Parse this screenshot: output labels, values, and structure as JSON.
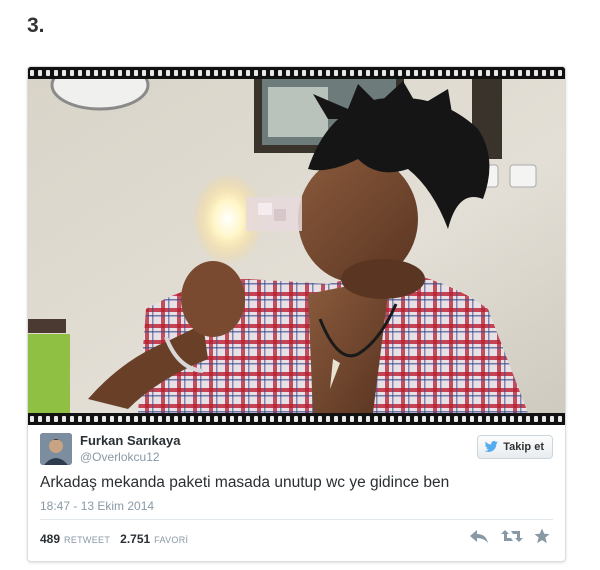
{
  "item_number": "3.",
  "tweet": {
    "display_name": "Furkan Sarıkaya",
    "handle": "@Overlokcu12",
    "follow_label": "Takip et",
    "text": "Arkadaş mekanda paketi masada unutup wc ye gidince ben",
    "timestamp": "18:47 - 13 Ekim 2014",
    "retweet_count": "489",
    "retweet_label": "RETWEET",
    "favorite_count": "2.751",
    "favorite_label": "FAVORİ"
  },
  "icons": {
    "follow": "twitter-bird-icon",
    "reply": "reply-icon",
    "retweet": "retweet-icon",
    "favorite": "star-icon"
  },
  "colors": {
    "twitter_blue": "#55acee",
    "muted_text": "#8899a6",
    "main_text": "#292f33"
  }
}
